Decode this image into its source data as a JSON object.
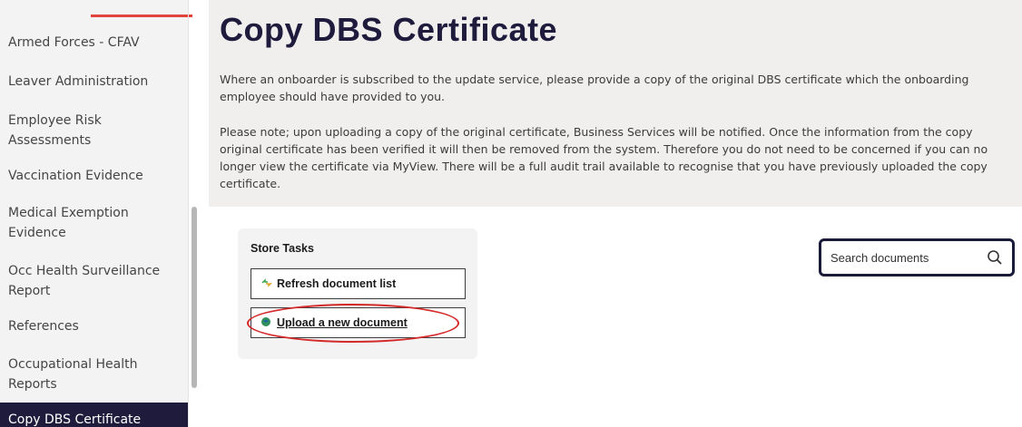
{
  "sidebar": {
    "items": [
      {
        "label": "Armed Forces - CFAV"
      },
      {
        "label": "Leaver Administration"
      },
      {
        "label": "Employee Risk\nAssessments"
      },
      {
        "label": "Vaccination Evidence"
      },
      {
        "label": "Medical Exemption\nEvidence"
      },
      {
        "label": "Occ Health Surveillance\nReport"
      },
      {
        "label": "References"
      },
      {
        "label": "Occupational Health\nReports"
      },
      {
        "label": "Copy DBS Certificate"
      }
    ],
    "active_index": 8
  },
  "main": {
    "title": "Copy DBS Certificate",
    "paragraph_1": "Where an onboarder is subscribed to the update service, please provide a copy of the original DBS certificate which the onboarding employee should have provided to you.",
    "paragraph_2": "Please note; upon uploading a copy of the original certificate, Business Services will be notified. Once the information from the copy original certificate has been verified it will then be removed from the system. Therefore you do not need to be concerned if you can no longer view the certificate via MyView. There will be a full audit trail available to recognise that you have previously uploaded the copy certificate."
  },
  "store": {
    "title": "Store Tasks",
    "refresh_label": "Refresh document list",
    "upload_label": "Upload a new document"
  },
  "search": {
    "placeholder": "Search documents",
    "value": ""
  },
  "icons": {
    "refresh": "refresh-arrows-icon",
    "upload": "globe-upload-icon",
    "search": "magnifier-icon"
  },
  "colors": {
    "brand_navy": "#1e1b3d",
    "accent_red": "#e0443c",
    "highlight_red": "#d42a2a"
  }
}
